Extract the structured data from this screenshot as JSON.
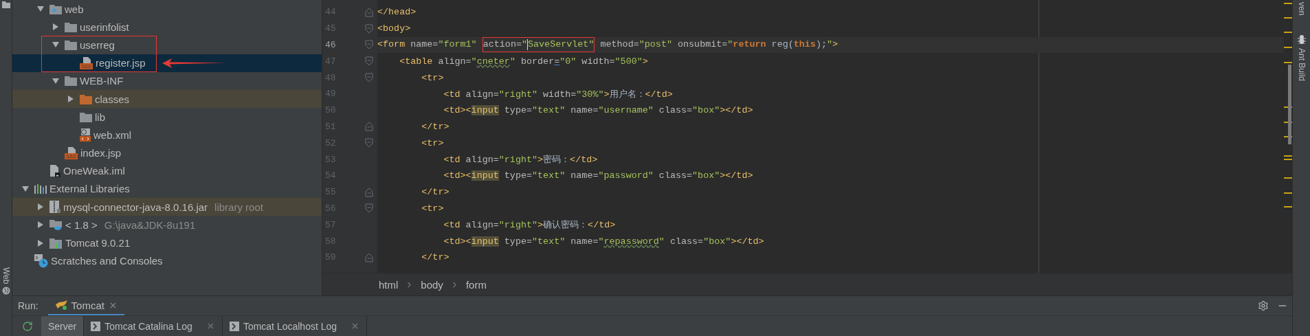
{
  "left_stripe": {
    "label": "Web"
  },
  "right_stripe": {
    "labels": [
      {
        "text": "ven",
        "kind": "plain"
      },
      {
        "text": "Ant Build",
        "kind": "ant"
      }
    ]
  },
  "project_tree": {
    "module_children": [
      {
        "label": "web",
        "kind": "folder-web",
        "expanded": true,
        "selected": false,
        "highlighted": false,
        "children": [
          {
            "label": "userinfolist",
            "kind": "folder",
            "expanded": false,
            "selected": false,
            "highlighted": false
          },
          {
            "label": "userreg",
            "kind": "folder",
            "expanded": true,
            "selected": false,
            "highlighted": false,
            "annotated": true,
            "children": [
              {
                "label": "register.jsp",
                "kind": "jsp",
                "selected": true
              }
            ]
          },
          {
            "label": "WEB-INF",
            "kind": "folder",
            "expanded": true,
            "selected": false,
            "highlighted": false,
            "children": [
              {
                "label": "classes",
                "kind": "folder-excluded",
                "expanded": false,
                "selected": false,
                "highlighted": true
              },
              {
                "label": "lib",
                "kind": "folder",
                "selected": false,
                "highlighted": false
              },
              {
                "label": "web.xml",
                "kind": "xml",
                "selected": false,
                "highlighted": false
              }
            ]
          },
          {
            "label": "index.jsp",
            "kind": "jsp",
            "selected": false,
            "highlighted": false
          }
        ]
      },
      {
        "label": "OneWeak.iml",
        "kind": "iml",
        "selected": false,
        "highlighted": false
      }
    ],
    "items": [
      {
        "label": "External Libraries",
        "kind": "libraries",
        "expanded": true,
        "selected": false,
        "highlighted": false,
        "children": [
          {
            "label": "mysql-connector-java-8.0.16.jar",
            "hint": "library root",
            "kind": "jar",
            "expanded": false,
            "selected": false,
            "highlighted": true
          },
          {
            "label": "< 1.8 >",
            "hint": "G:\\java&JDK-8u191",
            "kind": "jdk",
            "expanded": false,
            "selected": false,
            "highlighted": false
          },
          {
            "label": "Tomcat 9.0.21",
            "kind": "tomcat",
            "expanded": false,
            "selected": false,
            "highlighted": false
          }
        ]
      },
      {
        "label": "Scratches and Consoles",
        "kind": "scratches",
        "selected": false,
        "highlighted": false
      }
    ]
  },
  "editor": {
    "lines": [
      {
        "number": "44",
        "kind": "fold-end",
        "current": false,
        "tokens": [
          {
            "kind": "tag",
            "text": "</head>"
          }
        ]
      },
      {
        "number": "45",
        "kind": "fold-start",
        "current": false,
        "tokens": [
          {
            "kind": "tag",
            "text": "<body>"
          }
        ]
      },
      {
        "number": "46",
        "kind": "fold-start",
        "current": true,
        "tokens": [
          {
            "kind": "tag",
            "text": "<form"
          },
          {
            "kind": "attr",
            "text": " name="
          },
          {
            "kind": "value",
            "text": "\"form1\" "
          },
          {
            "kind": "box",
            "tokens": [
              {
                "kind": "attr",
                "text": "action="
              },
              {
                "kind": "value",
                "text": "\""
              },
              {
                "kind": "caret"
              },
              {
                "kind": "value",
                "text": "SaveServlet\""
              }
            ]
          },
          {
            "kind": "attr",
            "text": " method="
          },
          {
            "kind": "value",
            "text": "\"post\""
          },
          {
            "kind": "attr",
            "text": " onsubmit="
          },
          {
            "kind": "value",
            "text": "\""
          },
          {
            "kind": "keyword",
            "text": "return"
          },
          {
            "kind": "text",
            "text": " reg("
          },
          {
            "kind": "keyword",
            "text": "this"
          },
          {
            "kind": "text",
            "text": ");"
          },
          {
            "kind": "value",
            "text": "\""
          },
          {
            "kind": "tag",
            "text": ">"
          }
        ]
      },
      {
        "number": "47",
        "kind": "fold-start",
        "current": false,
        "tokens": [
          {
            "kind": "tag",
            "text": "    <table"
          },
          {
            "kind": "attr",
            "text": " align="
          },
          {
            "kind": "value",
            "text": "\""
          },
          {
            "kind": "typo",
            "text": "cneter"
          },
          {
            "kind": "value",
            "text": "\""
          },
          {
            "kind": "attr",
            "text": " border"
          },
          {
            "kind": "marked",
            "text": "="
          },
          {
            "kind": "value",
            "text": "\"0\""
          },
          {
            "kind": "attr",
            "text": " width="
          },
          {
            "kind": "value",
            "text": "\"500\""
          },
          {
            "kind": "tag",
            "text": ">"
          }
        ]
      },
      {
        "number": "48",
        "kind": "fold-start",
        "current": false,
        "tokens": [
          {
            "kind": "tag",
            "text": "        <tr>"
          }
        ]
      },
      {
        "number": "49",
        "kind": "plain",
        "current": false,
        "tokens": [
          {
            "kind": "tag",
            "text": "            <td"
          },
          {
            "kind": "attr",
            "text": " align="
          },
          {
            "kind": "value",
            "text": "\"right\""
          },
          {
            "kind": "attr",
            "text": " width="
          },
          {
            "kind": "value",
            "text": "\"30%\""
          },
          {
            "kind": "tag",
            "text": ">"
          },
          {
            "kind": "text",
            "text": "用户名："
          },
          {
            "kind": "tag",
            "text": "</td>"
          }
        ]
      },
      {
        "number": "50",
        "kind": "plain",
        "current": false,
        "tokens": [
          {
            "kind": "tag",
            "text": "            <td><"
          },
          {
            "kind": "match",
            "text": "input"
          },
          {
            "kind": "attr",
            "text": " type="
          },
          {
            "kind": "value",
            "text": "\"text\""
          },
          {
            "kind": "attr",
            "text": " name="
          },
          {
            "kind": "value",
            "text": "\"username\""
          },
          {
            "kind": "attr",
            "text": " class="
          },
          {
            "kind": "value",
            "text": "\"box\""
          },
          {
            "kind": "tag",
            "text": "></td>"
          }
        ]
      },
      {
        "number": "51",
        "kind": "fold-end",
        "current": false,
        "tokens": [
          {
            "kind": "tag",
            "text": "        </tr>"
          }
        ]
      },
      {
        "number": "52",
        "kind": "fold-start",
        "current": false,
        "tokens": [
          {
            "kind": "tag",
            "text": "        <tr>"
          }
        ]
      },
      {
        "number": "53",
        "kind": "plain",
        "current": false,
        "tokens": [
          {
            "kind": "tag",
            "text": "            <td"
          },
          {
            "kind": "attr",
            "text": " align="
          },
          {
            "kind": "value",
            "text": "\"right\""
          },
          {
            "kind": "tag",
            "text": ">"
          },
          {
            "kind": "text",
            "text": "密码："
          },
          {
            "kind": "tag",
            "text": "</td>"
          }
        ]
      },
      {
        "number": "54",
        "kind": "plain",
        "current": false,
        "tokens": [
          {
            "kind": "tag",
            "text": "            <td><"
          },
          {
            "kind": "match",
            "text": "input"
          },
          {
            "kind": "attr",
            "text": " type="
          },
          {
            "kind": "value",
            "text": "\"text\""
          },
          {
            "kind": "attr",
            "text": " name="
          },
          {
            "kind": "value",
            "text": "\"password\""
          },
          {
            "kind": "attr",
            "text": " class="
          },
          {
            "kind": "value",
            "text": "\"box\""
          },
          {
            "kind": "tag",
            "text": "></td>"
          }
        ]
      },
      {
        "number": "55",
        "kind": "fold-end",
        "current": false,
        "tokens": [
          {
            "kind": "tag",
            "text": "        </tr>"
          }
        ]
      },
      {
        "number": "56",
        "kind": "fold-start",
        "current": false,
        "tokens": [
          {
            "kind": "tag",
            "text": "        <tr>"
          }
        ]
      },
      {
        "number": "57",
        "kind": "plain",
        "current": false,
        "tokens": [
          {
            "kind": "tag",
            "text": "            <td"
          },
          {
            "kind": "attr",
            "text": " align="
          },
          {
            "kind": "value",
            "text": "\"right\""
          },
          {
            "kind": "tag",
            "text": ">"
          },
          {
            "kind": "text",
            "text": "确认密码："
          },
          {
            "kind": "tag",
            "text": "</td>"
          }
        ]
      },
      {
        "number": "58",
        "kind": "plain",
        "current": false,
        "tokens": [
          {
            "kind": "tag",
            "text": "            <td><"
          },
          {
            "kind": "match",
            "text": "input"
          },
          {
            "kind": "attr",
            "text": " type="
          },
          {
            "kind": "value",
            "text": "\"text\""
          },
          {
            "kind": "attr",
            "text": " name="
          },
          {
            "kind": "value",
            "text": "\""
          },
          {
            "kind": "typo",
            "text": "repassword"
          },
          {
            "kind": "value",
            "text": "\""
          },
          {
            "kind": "attr",
            "text": " class="
          },
          {
            "kind": "value",
            "text": "\"box\""
          },
          {
            "kind": "tag",
            "text": "></td>"
          }
        ]
      },
      {
        "number": "59",
        "kind": "fold-end",
        "current": false,
        "tokens": [
          {
            "kind": "tag",
            "text": "        </tr>"
          }
        ]
      }
    ],
    "breadcrumbs": [
      "html",
      "body",
      "form"
    ]
  },
  "run_panel": {
    "label": "Run:",
    "tabs": [
      {
        "label": "Tomcat",
        "selected": true
      }
    ],
    "sub_tabs": [
      {
        "label": "Server",
        "kind": "plain",
        "selected": true,
        "closable": false
      },
      {
        "label": "Tomcat Catalina Log",
        "kind": "console",
        "selected": false,
        "closable": true
      },
      {
        "label": "Tomcat Localhost Log",
        "kind": "console",
        "selected": false,
        "closable": true
      }
    ]
  }
}
